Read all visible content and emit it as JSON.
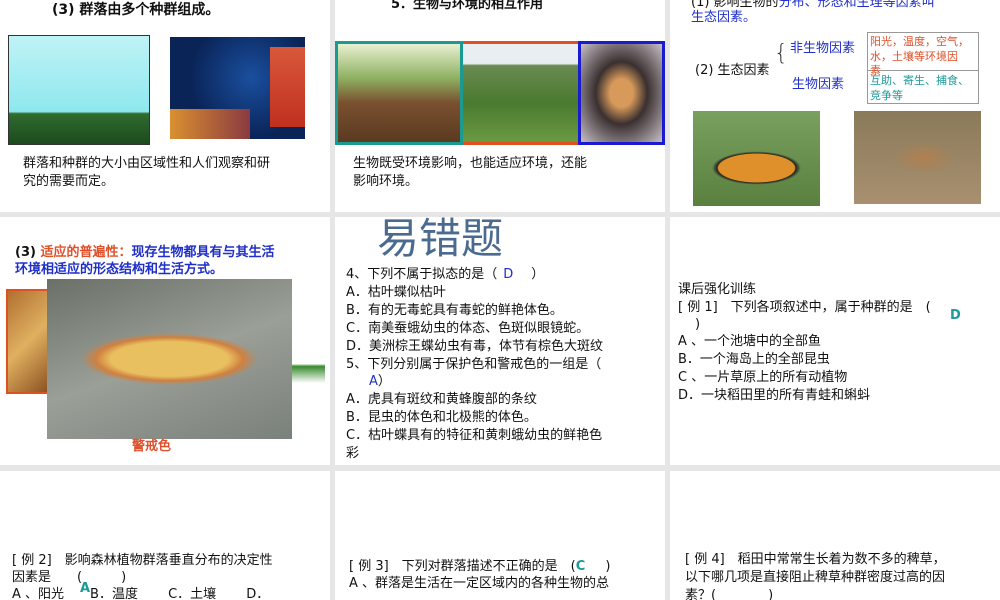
{
  "slides": [
    {
      "title": "(3) 群落由多个种群组成。",
      "body": [
        "群落和种群的大小由区域性和人们观察和研",
        "究的需要而定。"
      ]
    },
    {
      "title": "5．生物与环境的相互作用",
      "body": [
        "生物既受环境影响，也能适应环境，还能",
        "影响环境。"
      ]
    },
    {
      "line1_prefix": "(1) 影响生物的",
      "line1_mid": "分布、形态和生理等因素叫",
      "line2": "生态因素。",
      "label": "(2) 生态因素",
      "abiotic": "非生物因素",
      "biotic": "生物因素",
      "abiotic_desc": [
        "阳光，温度，空气，",
        "水，土壤等环境因",
        "素"
      ],
      "biotic_desc": [
        "互助、寄生、捕食、",
        "竞争等"
      ]
    },
    {
      "prefix": "(3)",
      "highlight": "适应的普遍性：",
      "rest1": "现存生物都具有与其生活",
      "rest2": "环境相适应的形态结构和生活方式。",
      "caption": "警戒色"
    },
    {
      "heading": "易错题",
      "q4": "4、下列不属于拟态的是（",
      "q4_answer": "D",
      "q4_close": "）",
      "q4_options": [
        "A．枯叶蝶似枯叶",
        "B．有的无毒蛇具有毒蛇的鲜艳体色。",
        "C．南美蚕蛾幼虫的体态、色斑似眼镜蛇。",
        "D．美洲棕王蝶幼虫有毒，体节有棕色大斑纹"
      ],
      "q5": "5、下列分别属于保护色和警戒色的一组是（",
      "q5_answer": "A",
      "q5_close": "）",
      "q5_options": [
        "A．虎具有斑纹和黄蜂腹部的条纹",
        "B．昆虫的体色和北极熊的体色。",
        "C．枯叶蝶具有的特征和黄刺蛾幼虫的鲜艳色",
        "彩"
      ]
    },
    {
      "heading": "课后强化训练",
      "q": "[ 例 1]　下列各项叙述中，属于种群的是　(",
      "answer": "D",
      "close": ")",
      "options": [
        "A 、一个池塘中的全部鱼",
        "B．一个海岛上的全部昆虫",
        "C 、一片草原上的所有动植物",
        "D．一块稻田里的所有青蛙和蝌蚪"
      ]
    },
    {
      "q1": "[ 例 2]　影响森林植物群落垂直分布的决定性",
      "q2": "因素是　　(　　　)",
      "answer": "A",
      "options": "A 、阳光　　B．温度　　 C．土壤　　 D．"
    },
    {
      "q": "[ 例 3]　下列对群落描述不正确的是　(",
      "answer": "C",
      "close": ")",
      "option": "A 、群落是生活在一定区域内的各种生物的总"
    },
    {
      "q1": "[ 例 4]　稻田中常常生长着为数不多的稗草，",
      "q2": "以下哪几项是直接阻止稗草种群密度过高的因",
      "q3": "素？(　　　　)"
    }
  ]
}
